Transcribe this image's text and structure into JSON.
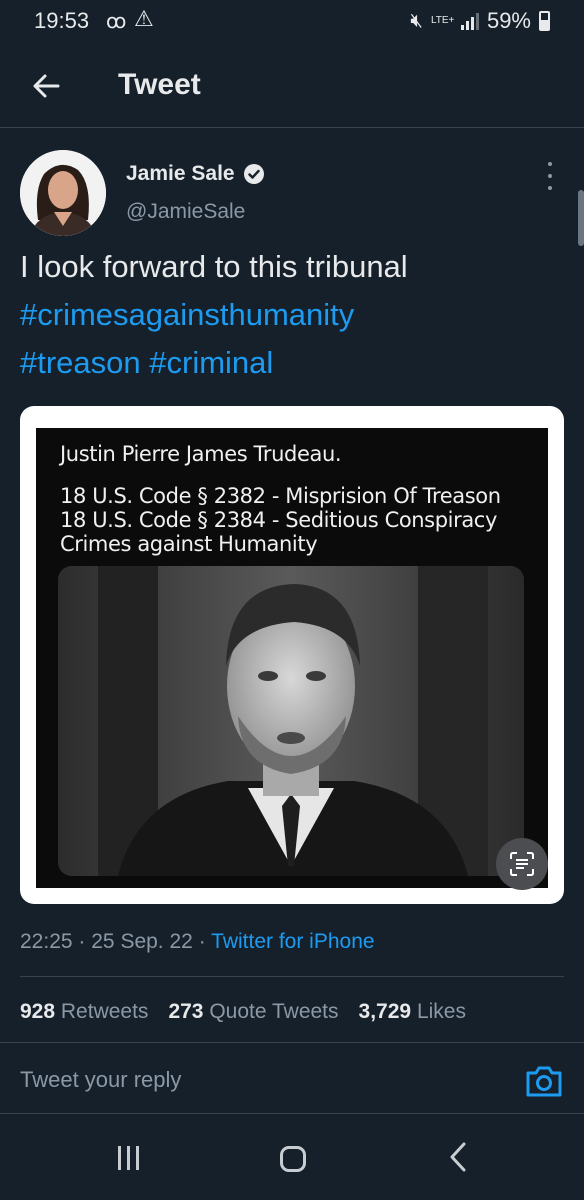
{
  "status_bar": {
    "time": "19:53",
    "network": "LTE+",
    "battery": "59%",
    "icons": [
      "voicemail-icon",
      "warning-icon",
      "mute-icon",
      "signal-icon",
      "battery-icon"
    ]
  },
  "header": {
    "title": "Tweet",
    "back_icon": "arrow-left-icon"
  },
  "tweet": {
    "author_name": "Jamie Sale",
    "author_handle": "@JamieSale",
    "text": "I look forward to this tribunal",
    "hashtags": [
      "#crimesagainsthumanity",
      "#treason",
      "#criminal"
    ],
    "media": {
      "lines": [
        "Justin Pierre James Trudeau.",
        "18 U.S. Code § 2382 - Misprision Of Treason",
        "18 U.S. Code § 2384 - Seditious Conspiracy",
        "Crimes against Humanity"
      ]
    },
    "time": "22:25",
    "date": "25 Sep. 22",
    "separator": "·",
    "source": "Twitter for iPhone",
    "stats": [
      {
        "count": "928",
        "label": "Retweets"
      },
      {
        "count": "273",
        "label": "Quote Tweets"
      },
      {
        "count": "3,729",
        "label": "Likes"
      }
    ]
  },
  "reply": {
    "placeholder": "Tweet your reply"
  },
  "colors": {
    "background": "#15202b",
    "accent": "#1d9bf0",
    "secondary_text": "#8b98a5",
    "divider": "#38444d"
  }
}
